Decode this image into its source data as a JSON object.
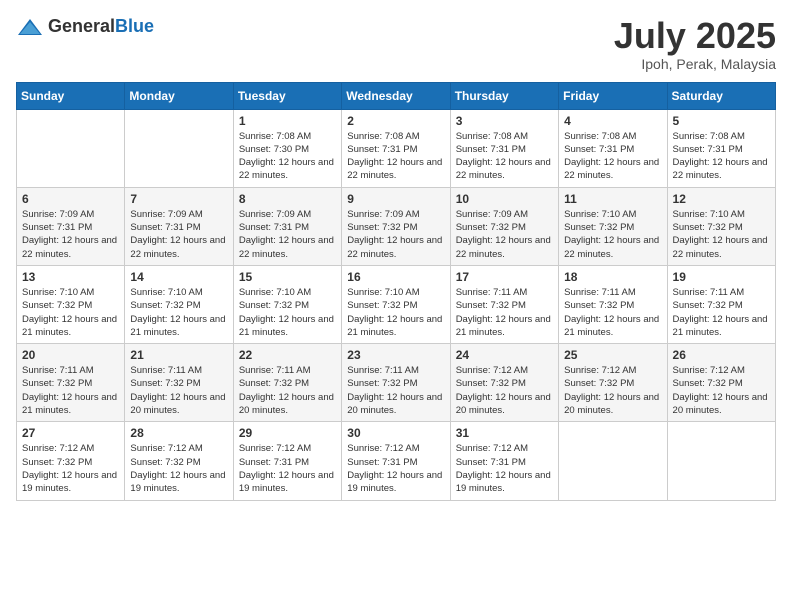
{
  "header": {
    "logo_general": "General",
    "logo_blue": "Blue",
    "month": "July 2025",
    "location": "Ipoh, Perak, Malaysia"
  },
  "weekdays": [
    "Sunday",
    "Monday",
    "Tuesday",
    "Wednesday",
    "Thursday",
    "Friday",
    "Saturday"
  ],
  "weeks": [
    [
      {
        "day": "",
        "info": ""
      },
      {
        "day": "",
        "info": ""
      },
      {
        "day": "1",
        "info": "Sunrise: 7:08 AM\nSunset: 7:30 PM\nDaylight: 12 hours and 22 minutes."
      },
      {
        "day": "2",
        "info": "Sunrise: 7:08 AM\nSunset: 7:31 PM\nDaylight: 12 hours and 22 minutes."
      },
      {
        "day": "3",
        "info": "Sunrise: 7:08 AM\nSunset: 7:31 PM\nDaylight: 12 hours and 22 minutes."
      },
      {
        "day": "4",
        "info": "Sunrise: 7:08 AM\nSunset: 7:31 PM\nDaylight: 12 hours and 22 minutes."
      },
      {
        "day": "5",
        "info": "Sunrise: 7:08 AM\nSunset: 7:31 PM\nDaylight: 12 hours and 22 minutes."
      }
    ],
    [
      {
        "day": "6",
        "info": "Sunrise: 7:09 AM\nSunset: 7:31 PM\nDaylight: 12 hours and 22 minutes."
      },
      {
        "day": "7",
        "info": "Sunrise: 7:09 AM\nSunset: 7:31 PM\nDaylight: 12 hours and 22 minutes."
      },
      {
        "day": "8",
        "info": "Sunrise: 7:09 AM\nSunset: 7:31 PM\nDaylight: 12 hours and 22 minutes."
      },
      {
        "day": "9",
        "info": "Sunrise: 7:09 AM\nSunset: 7:32 PM\nDaylight: 12 hours and 22 minutes."
      },
      {
        "day": "10",
        "info": "Sunrise: 7:09 AM\nSunset: 7:32 PM\nDaylight: 12 hours and 22 minutes."
      },
      {
        "day": "11",
        "info": "Sunrise: 7:10 AM\nSunset: 7:32 PM\nDaylight: 12 hours and 22 minutes."
      },
      {
        "day": "12",
        "info": "Sunrise: 7:10 AM\nSunset: 7:32 PM\nDaylight: 12 hours and 22 minutes."
      }
    ],
    [
      {
        "day": "13",
        "info": "Sunrise: 7:10 AM\nSunset: 7:32 PM\nDaylight: 12 hours and 21 minutes."
      },
      {
        "day": "14",
        "info": "Sunrise: 7:10 AM\nSunset: 7:32 PM\nDaylight: 12 hours and 21 minutes."
      },
      {
        "day": "15",
        "info": "Sunrise: 7:10 AM\nSunset: 7:32 PM\nDaylight: 12 hours and 21 minutes."
      },
      {
        "day": "16",
        "info": "Sunrise: 7:10 AM\nSunset: 7:32 PM\nDaylight: 12 hours and 21 minutes."
      },
      {
        "day": "17",
        "info": "Sunrise: 7:11 AM\nSunset: 7:32 PM\nDaylight: 12 hours and 21 minutes."
      },
      {
        "day": "18",
        "info": "Sunrise: 7:11 AM\nSunset: 7:32 PM\nDaylight: 12 hours and 21 minutes."
      },
      {
        "day": "19",
        "info": "Sunrise: 7:11 AM\nSunset: 7:32 PM\nDaylight: 12 hours and 21 minutes."
      }
    ],
    [
      {
        "day": "20",
        "info": "Sunrise: 7:11 AM\nSunset: 7:32 PM\nDaylight: 12 hours and 21 minutes."
      },
      {
        "day": "21",
        "info": "Sunrise: 7:11 AM\nSunset: 7:32 PM\nDaylight: 12 hours and 20 minutes."
      },
      {
        "day": "22",
        "info": "Sunrise: 7:11 AM\nSunset: 7:32 PM\nDaylight: 12 hours and 20 minutes."
      },
      {
        "day": "23",
        "info": "Sunrise: 7:11 AM\nSunset: 7:32 PM\nDaylight: 12 hours and 20 minutes."
      },
      {
        "day": "24",
        "info": "Sunrise: 7:12 AM\nSunset: 7:32 PM\nDaylight: 12 hours and 20 minutes."
      },
      {
        "day": "25",
        "info": "Sunrise: 7:12 AM\nSunset: 7:32 PM\nDaylight: 12 hours and 20 minutes."
      },
      {
        "day": "26",
        "info": "Sunrise: 7:12 AM\nSunset: 7:32 PM\nDaylight: 12 hours and 20 minutes."
      }
    ],
    [
      {
        "day": "27",
        "info": "Sunrise: 7:12 AM\nSunset: 7:32 PM\nDaylight: 12 hours and 19 minutes."
      },
      {
        "day": "28",
        "info": "Sunrise: 7:12 AM\nSunset: 7:32 PM\nDaylight: 12 hours and 19 minutes."
      },
      {
        "day": "29",
        "info": "Sunrise: 7:12 AM\nSunset: 7:31 PM\nDaylight: 12 hours and 19 minutes."
      },
      {
        "day": "30",
        "info": "Sunrise: 7:12 AM\nSunset: 7:31 PM\nDaylight: 12 hours and 19 minutes."
      },
      {
        "day": "31",
        "info": "Sunrise: 7:12 AM\nSunset: 7:31 PM\nDaylight: 12 hours and 19 minutes."
      },
      {
        "day": "",
        "info": ""
      },
      {
        "day": "",
        "info": ""
      }
    ]
  ]
}
